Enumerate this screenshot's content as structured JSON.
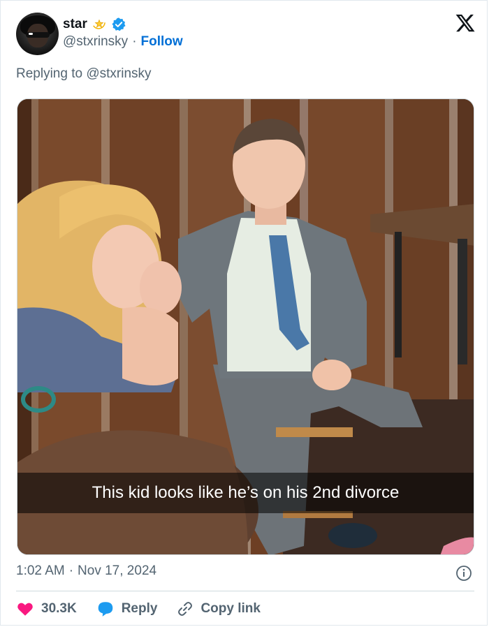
{
  "user": {
    "name": "star",
    "name_emoji": "💫",
    "handle": "@stxrinsky",
    "separator": "·",
    "follow_label": "Follow"
  },
  "replying_to": "Replying to @stxrinsky",
  "media": {
    "caption": "This kid looks like he’s on his 2nd divorce"
  },
  "meta": {
    "time": "1:02 AM",
    "separator": "·",
    "date": "Nov 17, 2024"
  },
  "actions": {
    "likes": "30.3K",
    "reply_label": "Reply",
    "copy_link_label": "Copy link"
  },
  "colors": {
    "accent": "#006fd6",
    "like": "#f91880",
    "reply": "#1d9bf0",
    "muted": "#536471",
    "verified": "#1d9bf0"
  },
  "icons": [
    "x-logo-icon",
    "verified-badge-icon",
    "dizzy-star-icon",
    "info-icon",
    "heart-icon",
    "reply-bubble-icon",
    "link-icon"
  ]
}
